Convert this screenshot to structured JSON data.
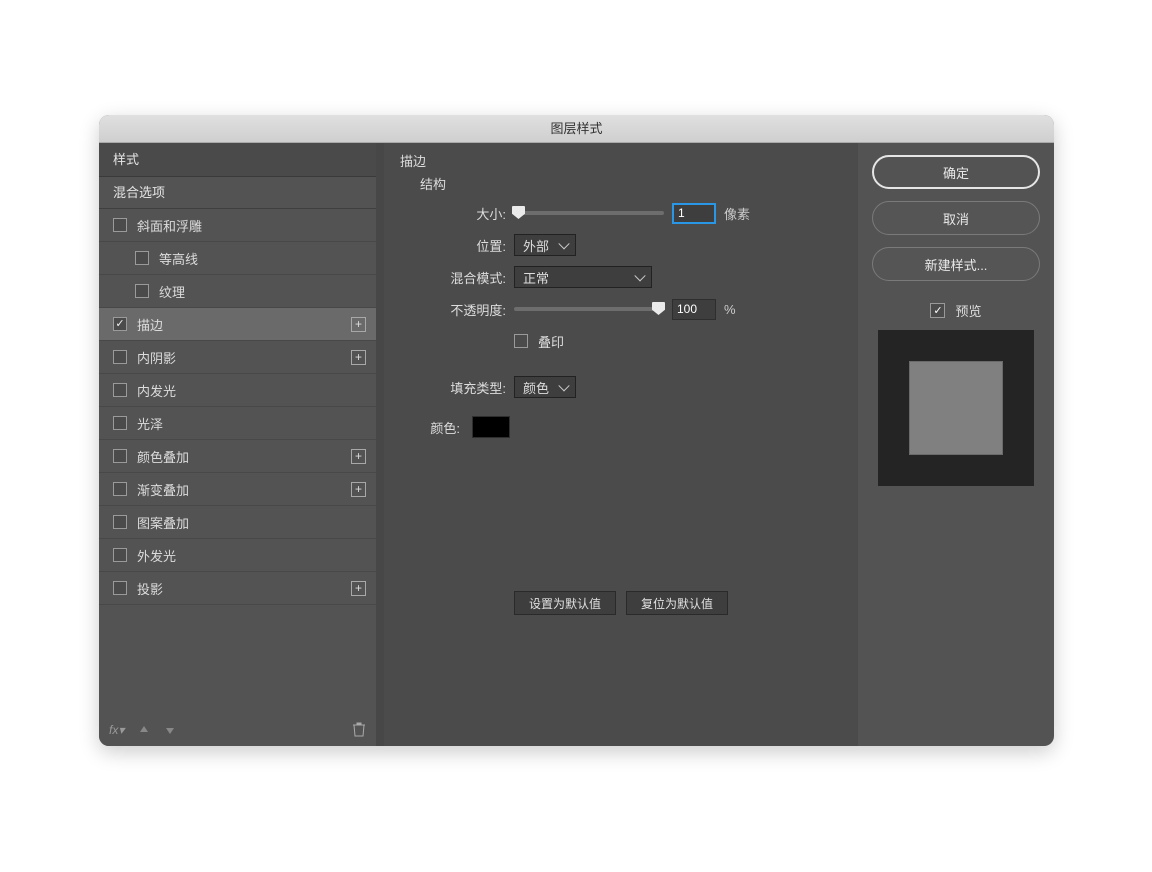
{
  "dialog": {
    "title": "图层样式"
  },
  "sidebar": {
    "header": "样式",
    "subheader": "混合选项",
    "items": [
      {
        "label": "斜面和浮雕",
        "checked": false,
        "indent": false,
        "plus": false,
        "selected": false
      },
      {
        "label": "等高线",
        "checked": false,
        "indent": true,
        "plus": false,
        "selected": false
      },
      {
        "label": "纹理",
        "checked": false,
        "indent": true,
        "plus": false,
        "selected": false
      },
      {
        "label": "描边",
        "checked": true,
        "indent": false,
        "plus": true,
        "selected": true
      },
      {
        "label": "内阴影",
        "checked": false,
        "indent": false,
        "plus": true,
        "selected": false
      },
      {
        "label": "内发光",
        "checked": false,
        "indent": false,
        "plus": false,
        "selected": false
      },
      {
        "label": "光泽",
        "checked": false,
        "indent": false,
        "plus": false,
        "selected": false
      },
      {
        "label": "颜色叠加",
        "checked": false,
        "indent": false,
        "plus": true,
        "selected": false
      },
      {
        "label": "渐变叠加",
        "checked": false,
        "indent": false,
        "plus": true,
        "selected": false
      },
      {
        "label": "图案叠加",
        "checked": false,
        "indent": false,
        "plus": false,
        "selected": false
      },
      {
        "label": "外发光",
        "checked": false,
        "indent": false,
        "plus": false,
        "selected": false
      },
      {
        "label": "投影",
        "checked": false,
        "indent": false,
        "plus": true,
        "selected": false
      }
    ]
  },
  "panel": {
    "section_title": "描边",
    "group_structure": "结构",
    "size_label": "大小:",
    "size_value": "1",
    "size_unit": "像素",
    "position_label": "位置:",
    "position_value": "外部",
    "blend_label": "混合模式:",
    "blend_value": "正常",
    "opacity_label": "不透明度:",
    "opacity_value": "100",
    "opacity_unit": "%",
    "overprint_label": "叠印",
    "filltype_label": "填充类型:",
    "filltype_value": "颜色",
    "color_label": "颜色:",
    "btn_default": "设置为默认值",
    "btn_reset": "复位为默认值"
  },
  "right": {
    "ok": "确定",
    "cancel": "取消",
    "new_style": "新建样式...",
    "preview": "预览"
  }
}
